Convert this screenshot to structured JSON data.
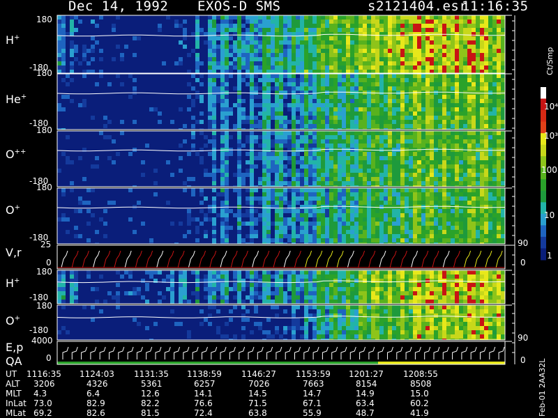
{
  "header": {
    "date": "Dec 14, 1992",
    "mission": "EXOS-D SMS",
    "file": "s2121404.esr",
    "time": "11:16:35"
  },
  "panels": [
    {
      "id": "h1",
      "ion": "H",
      "charge": "+",
      "top": "180",
      "bottom": "-180"
    },
    {
      "id": "he",
      "ion": "He",
      "charge": "+",
      "top": "180",
      "bottom": "-180"
    },
    {
      "id": "opp",
      "ion": "O",
      "charge": "++",
      "top": "180",
      "bottom": "-180"
    },
    {
      "id": "o1",
      "ion": "O",
      "charge": "+",
      "top": "180",
      "bottom": "-180"
    },
    {
      "id": "vr",
      "ion": "V,r",
      "charge": "",
      "top": "25",
      "bottom": "0",
      "right_top": "90",
      "right_bottom": "0"
    },
    {
      "id": "h2",
      "ion": "H",
      "charge": "+",
      "top": "180",
      "bottom": "-180"
    },
    {
      "id": "o2",
      "ion": "O",
      "charge": "+",
      "top": "180",
      "bottom": "-180",
      "right_bottom": "90"
    },
    {
      "id": "ep",
      "ion": "E,p",
      "charge": "",
      "top": "4000",
      "bottom": "0",
      "right_bottom": "0"
    }
  ],
  "qa_label": "QA",
  "colorbar": {
    "unit": "Ct/Smp",
    "labels": [
      "10⁴",
      "10³",
      "100",
      "10",
      "1"
    ]
  },
  "footer_rows": [
    {
      "label": "UT",
      "values": [
        "1116:35",
        "1124:03",
        "1131:35",
        "1138:59",
        "1146:27",
        "1153:59",
        "1201:27",
        "1208:55"
      ]
    },
    {
      "label": "ALT",
      "values": [
        "3206",
        "4326",
        "5361",
        "6257",
        "7026",
        "7663",
        "8154",
        "8508"
      ]
    },
    {
      "label": "MLT",
      "values": [
        "4.3",
        "6.4",
        "12.6",
        "14.1",
        "14.5",
        "14.7",
        "14.9",
        "15.0"
      ]
    },
    {
      "label": "InLat",
      "values": [
        "73.0",
        "82.9",
        "82.2",
        "76.6",
        "71.5",
        "67.1",
        "63.4",
        "60.2"
      ]
    },
    {
      "label": "MLat",
      "values": [
        "69.2",
        "82.6",
        "81.5",
        "72.4",
        "63.8",
        "55.9",
        "48.7",
        "41.9"
      ]
    }
  ],
  "side_tag": "Feb-01 2AA32L",
  "colors": {
    "background": "#000000",
    "deep": "#0a1e7a",
    "cyan": "#2aa0d0",
    "green": "#2aa22a",
    "yellow": "#e8e81a",
    "red": "#c81414"
  },
  "chart_data": {
    "type": "heatmap",
    "title": "Dec 14, 1992   EXOS-D SMS",
    "x": [
      "1116:35",
      "1124:03",
      "1131:35",
      "1138:59",
      "1146:27",
      "1153:59",
      "1201:27",
      "1208:55"
    ],
    "ylim": [
      -180,
      180
    ],
    "color_scale": "log",
    "clim": [
      1,
      10000
    ],
    "series": [
      {
        "name": "H+",
        "levels": [
          0.5,
          0.1,
          0.1,
          1.0,
          1.4,
          2.2,
          2.8,
          3.0,
          2.6
        ]
      },
      {
        "name": "He+",
        "levels": [
          0.2,
          0.1,
          0.1,
          0.6,
          1.0,
          1.6,
          2.1,
          2.3,
          2.2
        ]
      },
      {
        "name": "O++",
        "levels": [
          0.2,
          0.1,
          0.1,
          0.5,
          1.0,
          1.5,
          2.0,
          2.2,
          2.1
        ]
      },
      {
        "name": "O+",
        "levels": [
          0.2,
          0.1,
          0.1,
          0.5,
          1.0,
          1.4,
          1.9,
          2.1,
          2.0
        ]
      },
      {
        "name": "H+",
        "levels": [
          0.6,
          0.2,
          0.4,
          0.8,
          1.0,
          1.8,
          2.6,
          3.0,
          2.8
        ]
      },
      {
        "name": "O+",
        "levels": [
          0.1,
          0.1,
          0.1,
          0.2,
          0.3,
          1.6,
          2.3,
          2.8,
          2.5
        ]
      }
    ]
  }
}
